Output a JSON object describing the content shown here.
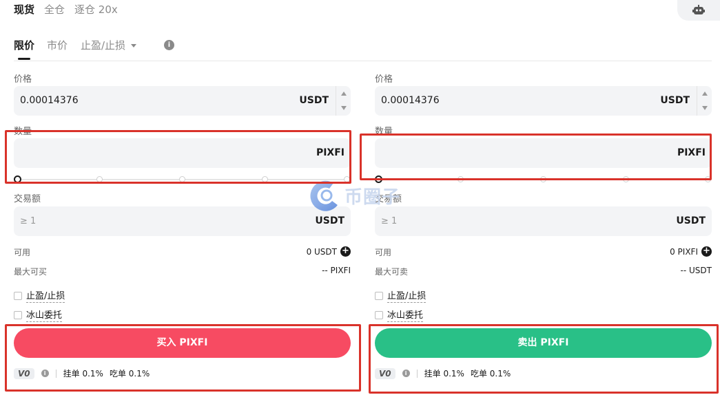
{
  "top_tabs": [
    "现货",
    "全仓",
    "逐仓 20x"
  ],
  "order_tabs": {
    "limit": "限价",
    "market": "市价",
    "tpsl": "止盈/止损"
  },
  "buy": {
    "price_label": "价格",
    "price_value": "0.00014376",
    "price_unit": "USDT",
    "qty_label": "数量",
    "qty_unit": "PIXFI",
    "amount_label": "交易额",
    "amount_placeholder": "≥ 1",
    "amount_unit": "USDT",
    "avail_label": "可用",
    "avail_value": "0 USDT",
    "max_label": "最大可买",
    "max_value": "-- PIXFI",
    "tpsl_label": "止盈/止损",
    "iceberg_label": "冰山委托",
    "action_label": "买入 PIXFI",
    "vip": "V0",
    "maker_fee": "挂单 0.1%",
    "taker_fee": "吃单 0.1%"
  },
  "sell": {
    "price_label": "价格",
    "price_value": "0.00014376",
    "price_unit": "USDT",
    "qty_label": "数量",
    "qty_unit": "PIXFI",
    "amount_label": "交易额",
    "amount_placeholder": "≥ 1",
    "amount_unit": "USDT",
    "avail_label": "可用",
    "avail_value": "0 PIXFI",
    "max_label": "最大可卖",
    "max_value": "-- USDT",
    "tpsl_label": "止盈/止损",
    "iceberg_label": "冰山委托",
    "action_label": "卖出 PIXFI",
    "vip": "V0",
    "maker_fee": "挂单 0.1%",
    "taker_fee": "吃单 0.1%"
  },
  "slider_value_percent": 0,
  "watermark_text": "币圈子",
  "colors": {
    "buy": "#f74b62",
    "sell": "#29c087",
    "highlight": "#d9322a"
  },
  "icons": [
    "robot-icon",
    "info-icon",
    "plus-icon",
    "caret-down-icon",
    "checkbox"
  ]
}
